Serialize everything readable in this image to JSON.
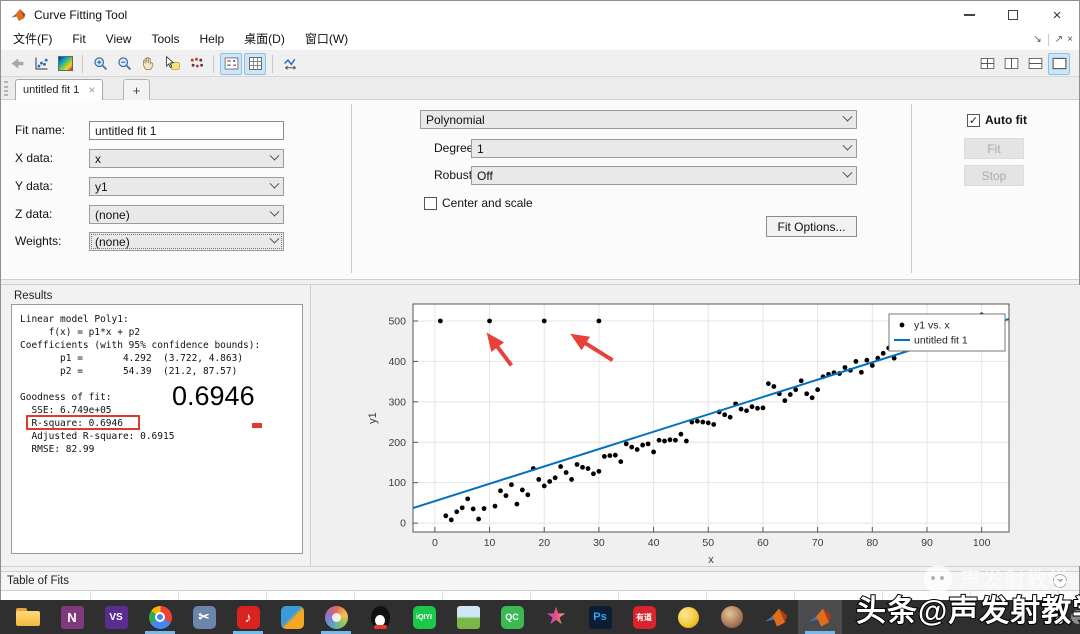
{
  "window": {
    "title": "Curve Fitting Tool"
  },
  "menu": {
    "items": [
      "文件(F)",
      "Fit",
      "View",
      "Tools",
      "Help",
      "桌面(D)",
      "窗口(W)"
    ],
    "dock_icons": [
      "↘",
      "↗",
      "×"
    ]
  },
  "toolbar": {
    "icons": [
      "print-disabled",
      "new-fit-plot",
      "colormap",
      "zoom-in",
      "zoom-out",
      "pan-hand",
      "datatip",
      "brush-data",
      "legend-toggle",
      "grid-toggle",
      "adjust-axes-limits"
    ],
    "selected_icons": [
      "legend-toggle",
      "grid-toggle",
      "layout-single"
    ],
    "layout_icons": [
      "layout-grid",
      "layout-columns",
      "layout-rows",
      "layout-single"
    ]
  },
  "tabs": {
    "active_title": "untitled fit 1",
    "close_glyph": "×",
    "new_tab_glyph": "+"
  },
  "fit_settings": {
    "fit_name_label": "Fit name:",
    "fit_name_value": "untitled fit 1",
    "x_data_label": "X data:",
    "x_data_value": "x",
    "y_data_label": "Y data:",
    "y_data_value": "y1",
    "z_data_label": "Z data:",
    "z_data_value": "(none)",
    "weights_label": "Weights:",
    "weights_value": "(none)",
    "model_type_value": "Polynomial",
    "degree_label": "Degree:",
    "degree_value": "1",
    "robust_label": "Robust:",
    "robust_value": "Off",
    "center_scale_label": "Center and scale",
    "center_scale_checked": false,
    "fit_options_label": "Fit Options...",
    "auto_fit_label": "Auto fit",
    "auto_fit_checked": true,
    "fit_button_label": "Fit",
    "stop_button_label": "Stop",
    "check_glyph": "✓"
  },
  "results": {
    "panel_label": "Results",
    "lines": [
      "Linear model Poly1:",
      "     f(x) = p1*x + p2",
      "Coefficients (with 95% confidence bounds):",
      "       p1 =       4.292  (3.722, 4.863)",
      "       p2 =       54.39  (21.2, 87.57)",
      "",
      "Goodness of fit:",
      "  SSE: 6.749e+05",
      "  R-square: 0.6946",
      "  Adjusted R-square: 0.6915",
      "  RMSE: 82.99"
    ],
    "highlighted_line": "R-square: 0.6946",
    "big_annotation": "0.6946",
    "annotation_color": "#e0392e"
  },
  "table_of_fits": {
    "label": "Table of Fits"
  },
  "chart_data": {
    "type": "scatter",
    "xlabel": "x",
    "ylabel": "y1",
    "xlim": [
      -4,
      105
    ],
    "ylim": [
      -22,
      542
    ],
    "xticks": [
      0,
      10,
      20,
      30,
      40,
      50,
      60,
      70,
      80,
      90,
      100
    ],
    "yticks": [
      0,
      100,
      200,
      300,
      400,
      500
    ],
    "grid": true,
    "legend_position": "top-right",
    "series": [
      {
        "name": "y1 vs. x",
        "type": "scatter",
        "color": "#000000",
        "points": [
          [
            1,
            500
          ],
          [
            10,
            500
          ],
          [
            20,
            500
          ],
          [
            30,
            500
          ],
          [
            100,
            515
          ],
          [
            2,
            18
          ],
          [
            3,
            8
          ],
          [
            4,
            28
          ],
          [
            5,
            38
          ],
          [
            6,
            60
          ],
          [
            7,
            35
          ],
          [
            8,
            10
          ],
          [
            9,
            36
          ],
          [
            11,
            42
          ],
          [
            12,
            80
          ],
          [
            13,
            68
          ],
          [
            14,
            95
          ],
          [
            15,
            47
          ],
          [
            16,
            82
          ],
          [
            17,
            70
          ],
          [
            18,
            135
          ],
          [
            19,
            108
          ],
          [
            20,
            92
          ],
          [
            21,
            103
          ],
          [
            22,
            112
          ],
          [
            23,
            140
          ],
          [
            24,
            125
          ],
          [
            25,
            108
          ],
          [
            26,
            145
          ],
          [
            27,
            138
          ],
          [
            28,
            135
          ],
          [
            29,
            122
          ],
          [
            30,
            128
          ],
          [
            31,
            165
          ],
          [
            32,
            167
          ],
          [
            33,
            168
          ],
          [
            34,
            152
          ],
          [
            35,
            196
          ],
          [
            36,
            188
          ],
          [
            37,
            182
          ],
          [
            38,
            193
          ],
          [
            39,
            196
          ],
          [
            40,
            176
          ],
          [
            41,
            205
          ],
          [
            42,
            203
          ],
          [
            43,
            206
          ],
          [
            44,
            205
          ],
          [
            45,
            220
          ],
          [
            46,
            203
          ],
          [
            47,
            250
          ],
          [
            48,
            252
          ],
          [
            49,
            250
          ],
          [
            50,
            248
          ],
          [
            51,
            244
          ],
          [
            52,
            275
          ],
          [
            53,
            268
          ],
          [
            54,
            262
          ],
          [
            55,
            295
          ],
          [
            56,
            282
          ],
          [
            57,
            278
          ],
          [
            58,
            288
          ],
          [
            59,
            284
          ],
          [
            60,
            285
          ],
          [
            61,
            345
          ],
          [
            62,
            338
          ],
          [
            63,
            320
          ],
          [
            64,
            303
          ],
          [
            65,
            318
          ],
          [
            66,
            330
          ],
          [
            67,
            352
          ],
          [
            68,
            320
          ],
          [
            69,
            310
          ],
          [
            70,
            330
          ],
          [
            71,
            362
          ],
          [
            72,
            368
          ],
          [
            73,
            372
          ],
          [
            74,
            370
          ],
          [
            75,
            385
          ],
          [
            76,
            378
          ],
          [
            77,
            400
          ],
          [
            78,
            373
          ],
          [
            79,
            403
          ],
          [
            80,
            390
          ],
          [
            81,
            408
          ],
          [
            82,
            420
          ],
          [
            83,
            433
          ],
          [
            84,
            408
          ]
        ]
      },
      {
        "name": "untitled fit 1",
        "type": "line",
        "color": "#0072bd",
        "equation": "y = p1*x + p2",
        "p1": 4.292,
        "p2": 54.39,
        "x_range": [
          -4,
          105
        ]
      }
    ],
    "annotations": {
      "arrow_color": "#e8413c",
      "arrows": [
        {
          "from": [
            14,
            390
          ],
          "to": [
            10,
            462
          ]
        },
        {
          "from": [
            32.5,
            403
          ],
          "to": [
            25.5,
            462
          ]
        }
      ]
    }
  },
  "taskbar": {
    "items": [
      {
        "name": "file-explorer",
        "shape": "folder"
      },
      {
        "name": "onenote",
        "shape": "square",
        "text": "N",
        "bg": "#80397b",
        "fg": "#fff",
        "fs": 13
      },
      {
        "name": "visual-studio",
        "shape": "square",
        "text": "VS",
        "bg": "#5c2d91",
        "fg": "#fff",
        "fs": 10
      },
      {
        "name": "chrome",
        "shape": "chrome",
        "running": true
      },
      {
        "name": "snipping-tool",
        "shape": "square",
        "text": "✂",
        "bg": "#6b86a8",
        "fg": "#fff",
        "fs": 13,
        "round": true
      },
      {
        "name": "netease-music",
        "shape": "square",
        "text": "♪",
        "bg": "#d8231f",
        "fg": "#fff",
        "fs": 14,
        "round": true,
        "running": true
      },
      {
        "name": "vmware",
        "shape": "square",
        "text": "",
        "bg": "linear-gradient(135deg,#3c9cd7 45%,#f5a623 55%)",
        "fg": "#fff",
        "fs": 10,
        "round": true
      },
      {
        "name": "paint",
        "shape": "palette",
        "running": true
      },
      {
        "name": "qq",
        "shape": "qq"
      },
      {
        "name": "iqiyi",
        "shape": "square",
        "text": "iQIYI",
        "bg": "#1cc749",
        "fg": "#fff",
        "fs": 7,
        "round": true
      },
      {
        "name": "photo-viewer",
        "shape": "square",
        "text": "",
        "bg": "linear-gradient(180deg,#cfe8f7 45%,#7ab648 55%)",
        "fg": "#fff",
        "fs": 9
      },
      {
        "name": "qc-app",
        "shape": "square",
        "text": "QC",
        "bg": "#3db954",
        "fg": "#fff",
        "fs": 9,
        "round": true
      },
      {
        "name": "star-app",
        "shape": "star"
      },
      {
        "name": "photoshop",
        "shape": "square",
        "text": "Ps",
        "bg": "#0b1e33",
        "fg": "#31a8ff",
        "fs": 11
      },
      {
        "name": "youdao-dict",
        "shape": "square",
        "text": "有道",
        "bg": "#d9232e",
        "fg": "#fff",
        "fs": 8,
        "round": true
      },
      {
        "name": "coin-app",
        "shape": "coin"
      },
      {
        "name": "user-avatar",
        "shape": "avatar"
      },
      {
        "name": "matlab",
        "shape": "matlab"
      },
      {
        "name": "matlab-active",
        "shape": "matlab",
        "active": true,
        "running": true
      }
    ]
  },
  "watermark": {
    "faint_text": "声发射教学",
    "bold_text": "头条@声发射教学"
  }
}
